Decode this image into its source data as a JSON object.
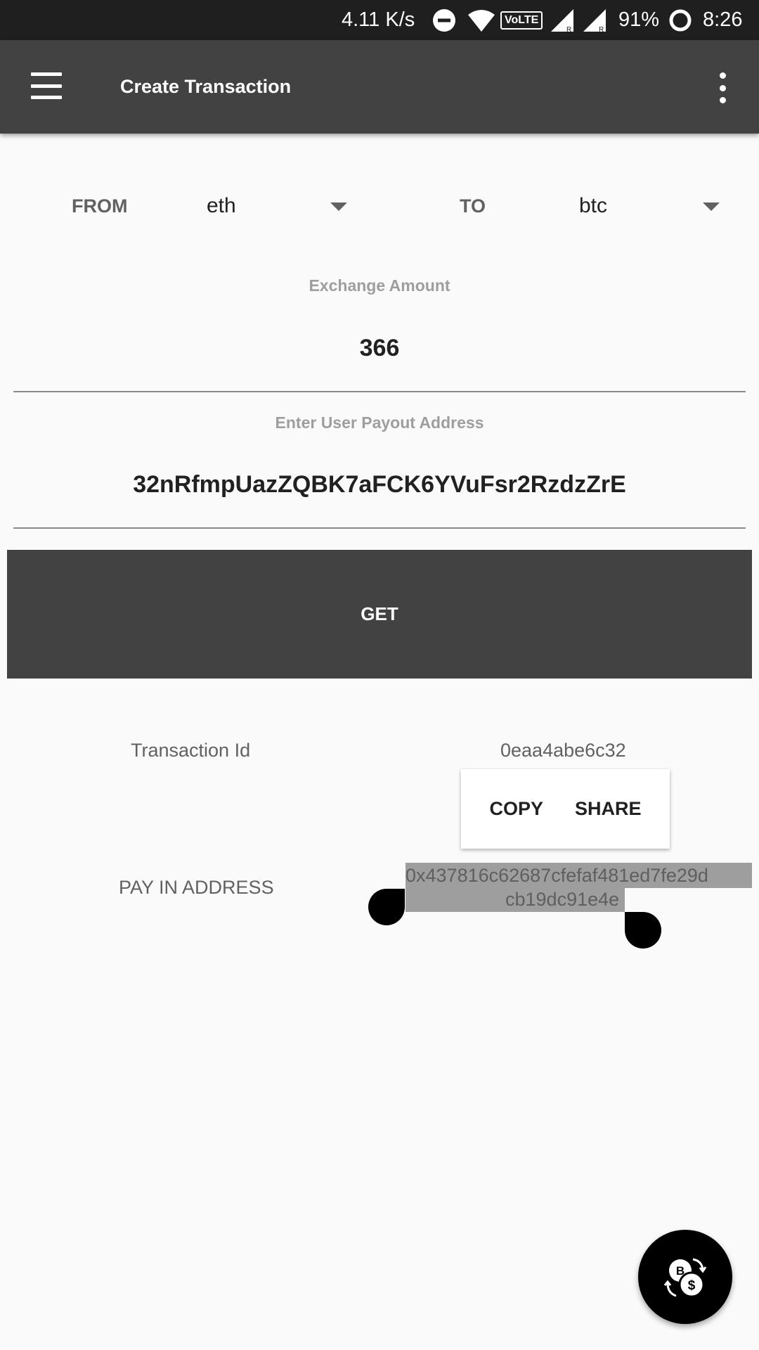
{
  "status_bar": {
    "net_speed": "4.11 K/s",
    "volte": "VoLTE",
    "battery": "91%",
    "time": "8:26"
  },
  "app_bar": {
    "title": "Create Transaction"
  },
  "exchange": {
    "from_label": "FROM",
    "from_value": "eth",
    "to_label": "TO",
    "to_value": "btc"
  },
  "amount": {
    "label": "Exchange Amount",
    "value": "366"
  },
  "payout": {
    "label": "Enter User Payout Address",
    "value": "32nRfmpUazZQBK7aFCK6YVuFsr2RzdzZrE"
  },
  "get_button": {
    "label": "GET"
  },
  "transaction": {
    "label": "Transaction Id",
    "value": "0eaa4abe6c32"
  },
  "context_menu": {
    "copy": "COPY",
    "share": "SHARE"
  },
  "pay_in": {
    "label": "PAY IN ADDRESS",
    "line1": "0x437816c62687cfefaf481ed7fe29d",
    "line2": "cb19dc91e4e"
  },
  "colors": {
    "app_bar": "#424242",
    "status_bar": "#1f1f1f",
    "button": "#424242",
    "selection": "#9e9e9e",
    "fab": "#000000"
  },
  "icons": {
    "menu": "hamburger-icon",
    "more": "overflow-icon",
    "fab": "currency-exchange-icon"
  }
}
